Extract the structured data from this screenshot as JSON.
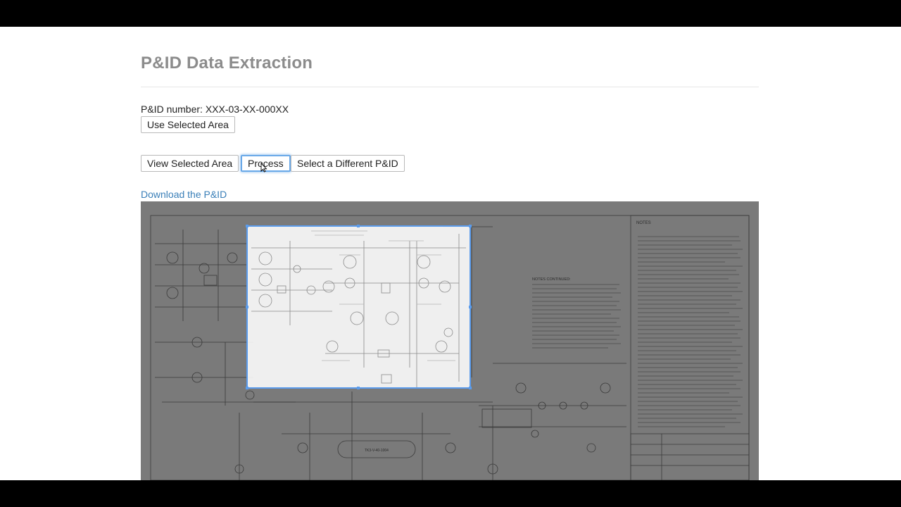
{
  "page_title": "P&ID Data Extraction",
  "pid_number_label": "P&ID number: XXX-03-XX-000XX",
  "buttons": {
    "use_selected_area": "Use Selected Area",
    "view_selected_area": "View Selected Area",
    "process": "Process",
    "select_different": "Select a Different P&ID"
  },
  "download_link": "Download the P&ID",
  "drawing": {
    "notes_heading": "NOTES",
    "notes_continued_heading": "NOTES CONTINUED:",
    "vessel_tag": "TK3-V-40-1004"
  },
  "colors": {
    "title": "#8c8c8c",
    "link": "#3a7fb8",
    "selection_border": "#5b9cec",
    "drawing_background": "#7a7a7a"
  }
}
